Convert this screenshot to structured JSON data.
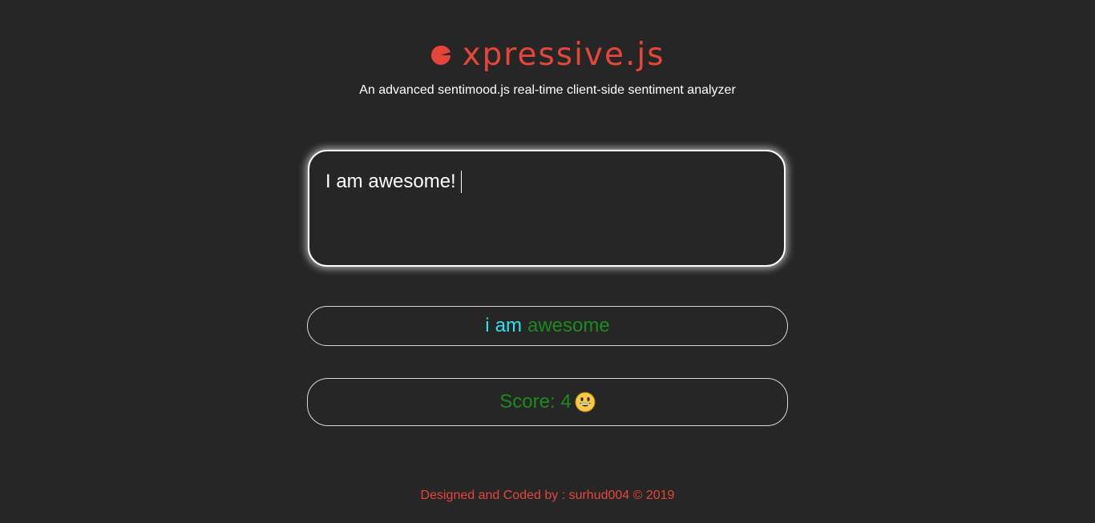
{
  "header": {
    "logo_icon": "pacman-e-icon",
    "title": "xpressive.js",
    "subtitle": "An advanced sentimood.js real-time client-side sentiment analyzer"
  },
  "editor": {
    "value": "I am awesome!"
  },
  "tokens": {
    "words": [
      {
        "text": "i",
        "sentiment": "neutral"
      },
      {
        "text": "am",
        "sentiment": "neutral"
      },
      {
        "text": "awesome",
        "sentiment": "positive"
      }
    ]
  },
  "score": {
    "label": "Score: 4",
    "emoji": "grinning-face-icon"
  },
  "footer": {
    "text": "Designed and Coded by : surhud004 © 2019"
  },
  "colors": {
    "background": "#262626",
    "accent": "#e6463a",
    "neutral_word": "#33e0f0",
    "positive_word": "#1c8a1c"
  }
}
